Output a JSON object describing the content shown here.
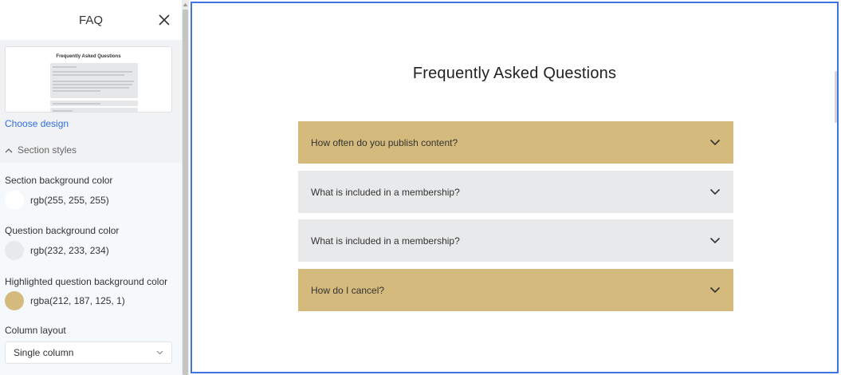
{
  "panel": {
    "title": "FAQ",
    "choose_design": "Choose design",
    "section_styles": "Section styles",
    "thumbnail": {
      "title": "Frequently Asked Questions",
      "item_1": "What is EASE1?",
      "item_2": "What is included in a book that feature and?",
      "item_3": "Where can I found?"
    },
    "settings": [
      {
        "label": "Section background color",
        "value": "rgb(255, 255, 255)",
        "color": "#ffffff"
      },
      {
        "label": "Question background color",
        "value": "rgb(232, 233, 234)",
        "color": "#e8e9ea"
      },
      {
        "label": "Highlighted question background color",
        "value": "rgba(212, 187, 125, 1)",
        "color": "#d4bb7d"
      }
    ],
    "column_layout": {
      "label": "Column layout",
      "value": "Single column"
    }
  },
  "preview": {
    "title": "Frequently Asked Questions",
    "questions": [
      {
        "text": "How often do you publish content?",
        "highlighted": true
      },
      {
        "text": "What is included in a membership?",
        "highlighted": false
      },
      {
        "text": "What is included in a membership?",
        "highlighted": false
      },
      {
        "text": "How do I cancel?",
        "highlighted": true
      }
    ]
  },
  "colors": {
    "accent": "#3d73e4",
    "link": "#2f6fde",
    "highlight": "#d4bb7d",
    "question_bg": "#e8e9ea"
  },
  "icons": [
    "close-icon",
    "chevron-up-icon",
    "chevron-down-icon"
  ]
}
